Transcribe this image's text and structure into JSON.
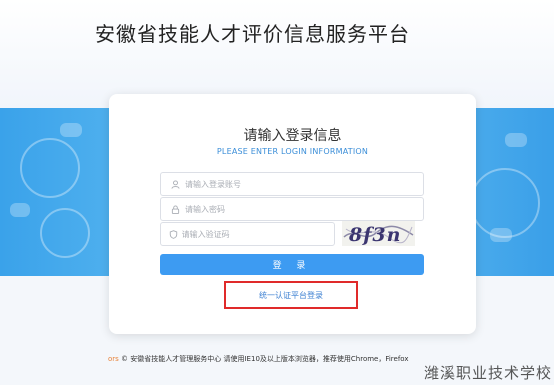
{
  "header": {
    "site_title": "安徽省技能人才评价信息服务平台"
  },
  "login": {
    "title": "请输入登录信息",
    "subtitle": "PLEASE ENTER LOGIN INFORMATION",
    "username_placeholder": "请输入登录账号",
    "password_placeholder": "请输入密码",
    "captcha_placeholder": "请输入验证码",
    "captcha_text": "8f3n",
    "submit_label": "登 录",
    "unified_login_label": "统一认证平台登录"
  },
  "footer": {
    "prefix": "ors",
    "text": "© 安徽省技能人才管理服务中心 请使用IE10及以上版本浏览器，推荐使用Chrome，Firefox"
  },
  "watermark": "潍溪职业技术学校",
  "colors": {
    "accent": "#3d9bf2",
    "link": "#3b7fd1",
    "highlight_box": "#e02a2a",
    "banner": "#58b6f0"
  },
  "icons": {
    "username": "user-icon",
    "password": "lock-icon",
    "captcha": "shield-icon"
  }
}
